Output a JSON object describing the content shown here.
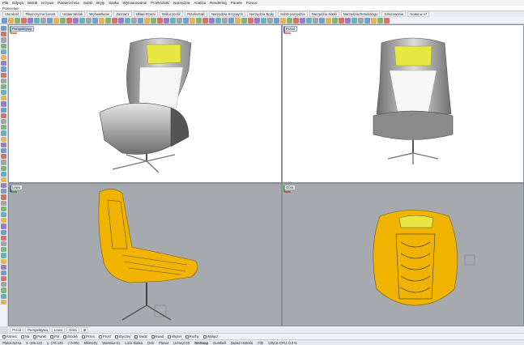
{
  "menu": [
    "Plik",
    "Edycja",
    "Widok",
    "Krzywa",
    "Powierzchnia",
    "SubD",
    "Bryły",
    "Siatka",
    "Wymiarowanie",
    "Przekształć",
    "Narzędzia",
    "Analiza",
    "Rendering",
    "Panele",
    "Pomoc"
  ],
  "command_prompt": "Polecenie:",
  "toolbar_tabs": [
    "Standard",
    "Płaszczyzna konstr.",
    "Ustaw Widok",
    "Wyświetlanie",
    "Zaznacz",
    "Układ Rzutni",
    "Widoczność",
    "Przekształć",
    "Narzędzia Krzywych",
    "Narzędzia Bryły",
    "SubD narzędzia",
    "Narzędzia Siatki",
    "Narzędzia Renderingu",
    "Szkicowanie",
    "Nowe w v7"
  ],
  "viewports": {
    "top_left": "Perspektywa",
    "top_right": "Przód",
    "bottom_left": "Lewo",
    "bottom_right": "Góra"
  },
  "viewport_tabs": [
    "Przód",
    "Perspektywa",
    "Lewo",
    "Góra"
  ],
  "osnap_items": [
    "Koniec",
    "Na",
    "Punkt",
    "Poł",
    "Środek",
    "Przec",
    "Prost",
    "Styczny",
    "Świąt",
    "Kwad",
    "Węzeł",
    "Ruchy",
    "Wyłącz"
  ],
  "status": {
    "cplane": "Płaszczyzna",
    "x": "x -105.122",
    "y": "y -176.140",
    "z": "z 0.000",
    "units": "Milimetry",
    "layer": "Warstwa 01",
    "items": [
      "Lock Siatka",
      "Orto",
      "Planar",
      "Uchwyt 0S",
      "SmSnap",
      "Gumball",
      "Zapisz Historię",
      "Filtr",
      "Użycie CPU: 0.0 %"
    ]
  },
  "colors": {
    "accent": "#f0b400",
    "viewport_bg_shaded": "#ffffff",
    "viewport_bg_xray": "#a6a9ae",
    "active_label": "#c9d9f3"
  }
}
